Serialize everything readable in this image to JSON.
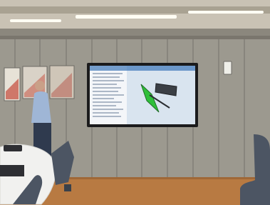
{
  "scene": {
    "description_visible_text": [],
    "colors": {
      "ceiling": "#c9c2b4",
      "wall": "#9c998f",
      "floor": "#b87a42",
      "tv_bezel": "#1b1b1c",
      "viewport_bg": "#d9e4ef",
      "model_green": "#2fbf3a",
      "model_dark": "#3b3f45",
      "desk": "#f1f1ef",
      "chair": "#4c5563",
      "shirt": "#9fb6d6"
    },
    "icons": [
      "tv-screen",
      "3d-model-green-panel",
      "3d-model-dark-panel",
      "laptop",
      "office-chair",
      "person",
      "wall-posters",
      "ceiling-light",
      "wall-switch"
    ]
  }
}
